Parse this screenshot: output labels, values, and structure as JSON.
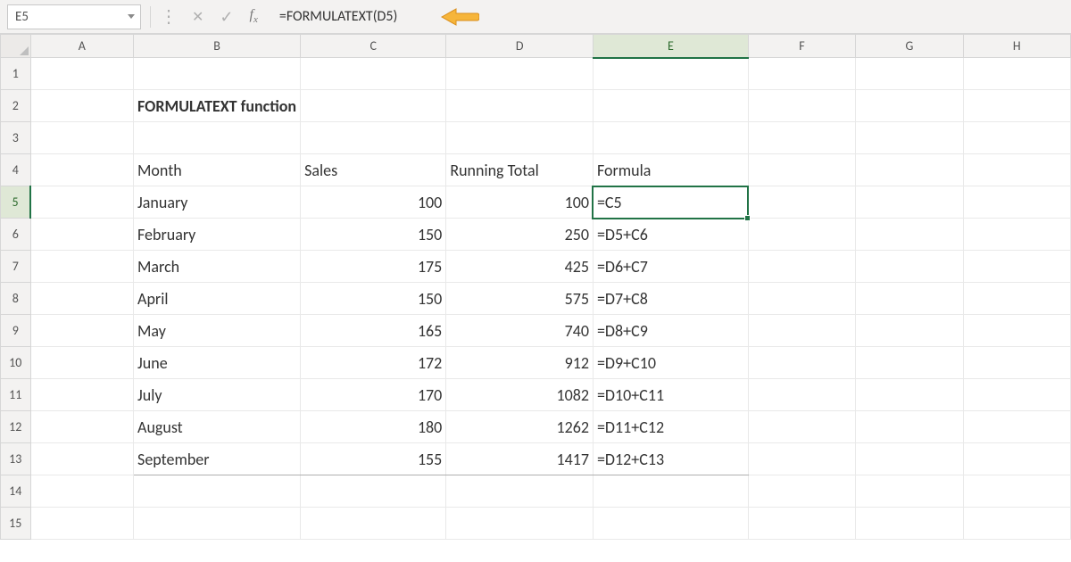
{
  "formula_bar": {
    "name_box": "E5",
    "formula_text": "=FORMULATEXT(D5)"
  },
  "columns": [
    "A",
    "B",
    "C",
    "D",
    "E",
    "F",
    "G",
    "H"
  ],
  "row_numbers": [
    1,
    2,
    3,
    4,
    5,
    6,
    7,
    8,
    9,
    10,
    11,
    12,
    13,
    14,
    15
  ],
  "active_col": "E",
  "active_row": 5,
  "title": "FORMULATEXT function",
  "table": {
    "headers": [
      "Month",
      "Sales",
      "Running Total",
      "Formula"
    ],
    "rows": [
      {
        "month": "January",
        "sales": 100,
        "running": 100,
        "formula": "=C5"
      },
      {
        "month": "February",
        "sales": 150,
        "running": 250,
        "formula": "=D5+C6"
      },
      {
        "month": "March",
        "sales": 175,
        "running": 425,
        "formula": "=D6+C7"
      },
      {
        "month": "April",
        "sales": 150,
        "running": 575,
        "formula": "=D7+C8"
      },
      {
        "month": "May",
        "sales": 165,
        "running": 740,
        "formula": "=D8+C9"
      },
      {
        "month": "June",
        "sales": 172,
        "running": 912,
        "formula": "=D9+C10"
      },
      {
        "month": "July",
        "sales": 170,
        "running": 1082,
        "formula": "=D10+C11"
      },
      {
        "month": "August",
        "sales": 180,
        "running": 1262,
        "formula": "=D11+C12"
      },
      {
        "month": "September",
        "sales": 155,
        "running": 1417,
        "formula": "=D12+C13"
      }
    ]
  }
}
